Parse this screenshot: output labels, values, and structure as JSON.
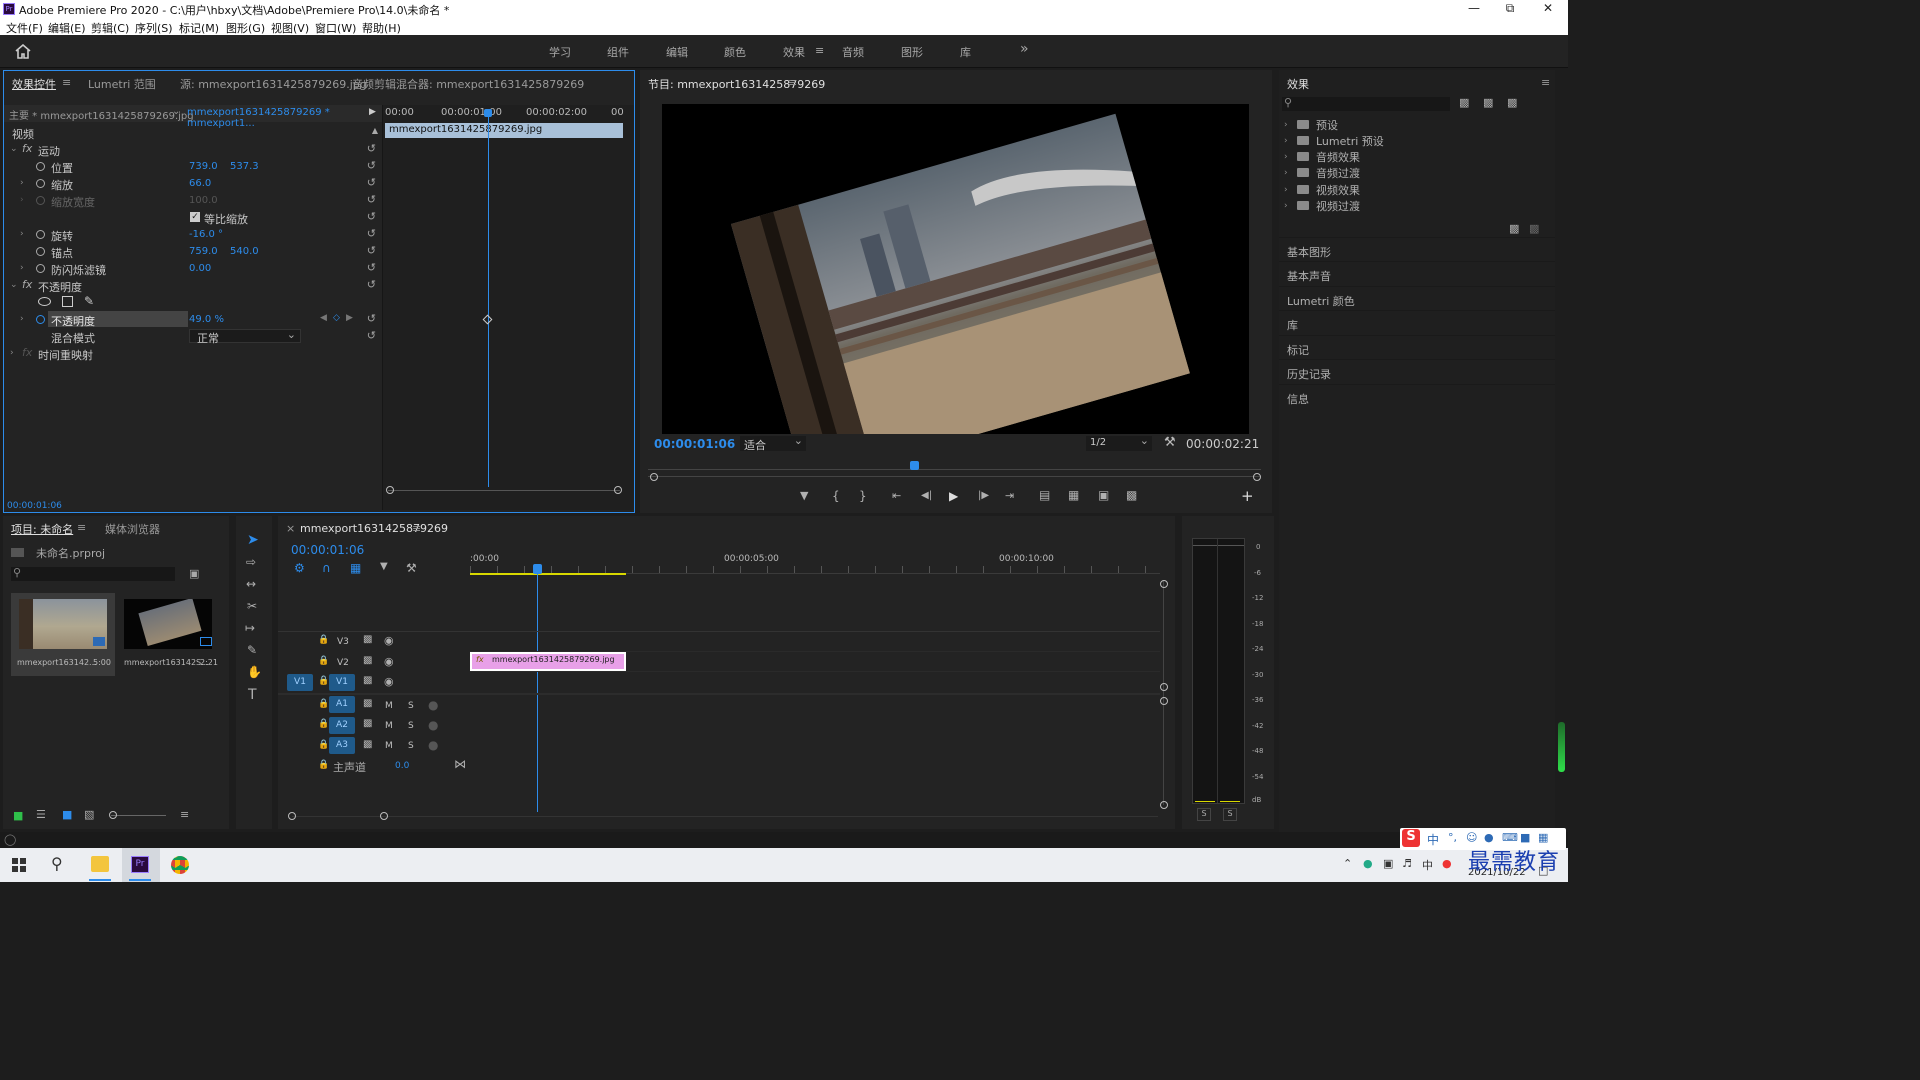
{
  "window": {
    "title": "Adobe Premiere Pro 2020 - C:\\用户\\hbxy\\文档\\Adobe\\Premiere Pro\\14.0\\未命名 *",
    "app_icon": "Pr"
  },
  "menu": [
    "文件(F)",
    "编辑(E)",
    "剪辑(C)",
    "序列(S)",
    "标记(M)",
    "图形(G)",
    "视图(V)",
    "窗口(W)",
    "帮助(H)"
  ],
  "workspaces": [
    "学习",
    "组件",
    "编辑",
    "颜色",
    "效果",
    "音频",
    "图形",
    "库"
  ],
  "workspace_active": "效果",
  "effect_controls": {
    "tabs": [
      "效果控件",
      "Lumetri 范围",
      "源: mmexport1631425879269.jpg",
      "音频剪辑混合器: mmexport1631425879269"
    ],
    "master": "主要 * mmexport1631425879269.jpg",
    "sequence_clip": "mmexport1631425879269 * mmexport1...",
    "section_video": "视频",
    "motion": "运动",
    "position_label": "位置",
    "position_x": "739.0",
    "position_y": "537.3",
    "scale_label": "缩放",
    "scale_value": "66.0",
    "scale_width_label": "缩放宽度",
    "scale_width_value": "100.0",
    "uniform_scale": "等比缩放",
    "rotation_label": "旋转",
    "rotation_value": "-16.0 °",
    "anchor_label": "锚点",
    "anchor_x": "759.0",
    "anchor_y": "540.0",
    "antiflicker_label": "防闪烁滤镜",
    "antiflicker_value": "0.00",
    "opacity_group": "不透明度",
    "opacity_label": "不透明度",
    "opacity_value": "49.0 %",
    "blend_label": "混合模式",
    "blend_value": "正常",
    "time_remap": "时间重映射",
    "ruler": [
      "00:00",
      "00:00:01:00",
      "00:00:02:00",
      "00"
    ],
    "clip_name": "mmexport1631425879269.jpg",
    "timecode": "00:00:01:06"
  },
  "program": {
    "title": "节目: mmexport1631425879269",
    "timecode": "00:00:01:06",
    "fit": "适合",
    "resolution": "1/2",
    "duration": "00:00:02:21"
  },
  "effects_panel": {
    "title": "效果",
    "tree": [
      "预设",
      "Lumetri 预设",
      "音频效果",
      "音频过渡",
      "视频效果",
      "视频过渡"
    ],
    "sections": [
      "基本图形",
      "基本声音",
      "Lumetri 颜色",
      "库",
      "标记",
      "历史记录",
      "信息"
    ]
  },
  "project": {
    "tabs": [
      "项目: 未命名",
      "媒体浏览器"
    ],
    "file": "未命名.prproj",
    "items": [
      {
        "name": "mmexport163142...",
        "duration": "5:00"
      },
      {
        "name": "mmexport163142S...",
        "duration": "2:21"
      }
    ]
  },
  "timeline": {
    "tab": "mmexport1631425879269",
    "timecode": "00:00:01:06",
    "ruler": [
      ":00:00",
      "00:00:05:00",
      "00:00:10:00"
    ],
    "video_tracks": [
      "V3",
      "V2",
      "V1"
    ],
    "audio_tracks": [
      "A1",
      "A2",
      "A3"
    ],
    "source_patch": "V1",
    "master_label": "主声道",
    "master_value": "0.0",
    "clip_label": "mmexport1631425879269.jpg",
    "clip_fx": "fx"
  },
  "meter": {
    "ticks": [
      "0",
      "-6",
      "-12",
      "-18",
      "-24",
      "-30",
      "-36",
      "-42",
      "-48",
      "-54",
      "dB"
    ],
    "solo": [
      "S",
      "S"
    ]
  },
  "taskbar": {
    "date": "2021/10/22",
    "ime": "中"
  },
  "watermark": "最需教育",
  "colors": {
    "accent": "#2d8ceb",
    "clip": "#e8a0e8",
    "panel_bg": "#232323",
    "app_bg": "#1d1d1d",
    "playhead": "#2d8ceb"
  }
}
